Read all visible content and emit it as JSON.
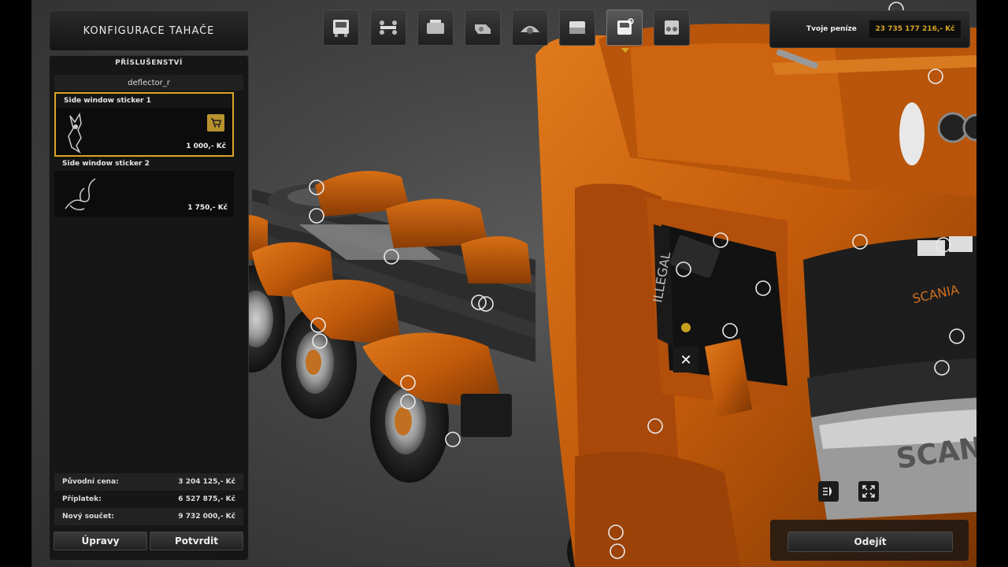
{
  "title": "KONFIGURACE TAHAČE",
  "panel": {
    "header": "PŘÍSLUŠENSTVÍ",
    "part_name": "deflector_r",
    "items": [
      {
        "label": "Side window sticker 1",
        "price": "1 000,- Kč",
        "selected": true
      },
      {
        "label": "Side window sticker 2",
        "price": "1 750,- Kč",
        "selected": false
      }
    ]
  },
  "totals": [
    {
      "label": "Původní cena:",
      "value": "3 204 125,- Kč"
    },
    {
      "label": "Příplatek:",
      "value": "6 527 875,- Kč"
    },
    {
      "label": "Nový součet:",
      "value": "9 732 000,- Kč"
    }
  ],
  "buttons": {
    "edit": "Úpravy",
    "confirm": "Potvrdit",
    "leave": "Odejít"
  },
  "money": {
    "label": "Tvoje peníze",
    "value": "23 735 177 216,- Kč"
  },
  "toolbar": [
    "cab-icon",
    "chassis-icon",
    "engine-icon",
    "transmission-icon",
    "interior-icon",
    "paint-icon",
    "accessories-icon",
    "lights-icon"
  ],
  "toolbar_active": 6,
  "truck_text": {
    "window_sticker": "ILLEGAL",
    "grille_brand": "SCANIA",
    "grille_logo": "SCANIA"
  },
  "colors": {
    "accent": "#d9a528",
    "truck_orange": "#c8600d"
  }
}
